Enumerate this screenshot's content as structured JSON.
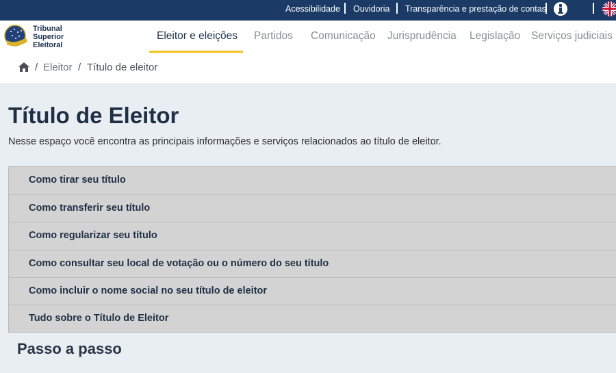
{
  "topbar": {
    "links": [
      "Acessibilidade",
      "Ouvidoria",
      "Transparência e prestação de contas"
    ],
    "info_icon": "info-icon",
    "language_icon": "uk-flag-icon"
  },
  "logo": {
    "lines": [
      "Tribunal",
      "Superior",
      "Eleitoral"
    ],
    "emblem_icon": "tse-emblem-icon"
  },
  "nav": {
    "items": [
      "Eleitor e eleições",
      "Partidos",
      "Comunicação",
      "Jurisprudência",
      "Legislação",
      "Serviços judiciais"
    ],
    "active_index": 0
  },
  "breadcrumb": {
    "home_icon": "home-icon",
    "items": [
      "Eleitor",
      "Título de eleitor"
    ]
  },
  "page": {
    "title": "Título de Eleitor",
    "subtitle": "Nesse espaço você encontra as principais informações e serviços relacionados ao título de eleitor."
  },
  "accordion": {
    "items": [
      "Como tirar seu título",
      "Como transferir seu título",
      "Como regularizar seu título",
      "Como consultar seu local de votação ou o número do seu título",
      "Como incluir o nome social no seu título de eleitor",
      "Tudo sobre o Título de Eleitor"
    ]
  },
  "section": {
    "heading": "Passo a passo"
  },
  "colors": {
    "topbar": "#1b3a66",
    "accent_underline": "#f2c21a",
    "page_background": "#e9eef3",
    "accordion_background": "#d3d3d3",
    "title_text": "#1f2f45"
  }
}
